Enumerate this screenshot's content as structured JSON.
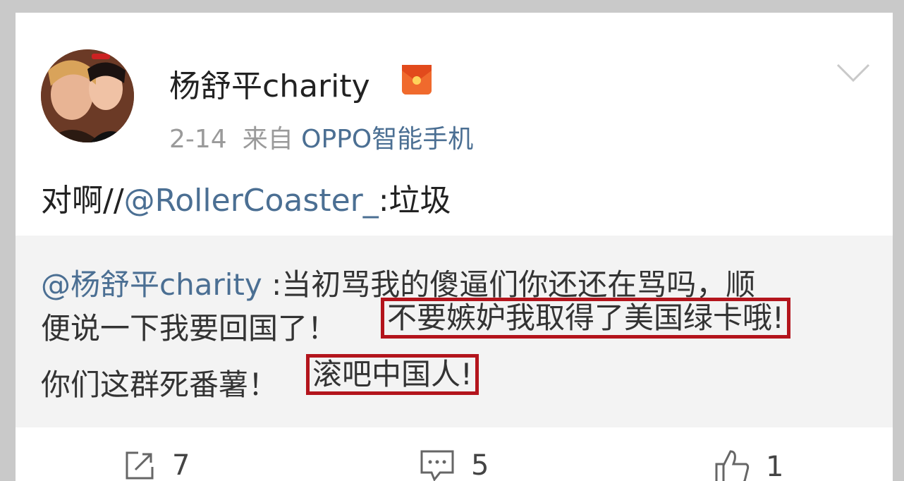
{
  "post": {
    "username": "杨舒平charity",
    "date": "2-14",
    "source_prefix": "来自",
    "source": "OPPO智能手机",
    "text_prefix": "对啊//",
    "text_mention": "@RollerCoaster_",
    "text_suffix": ":垃圾"
  },
  "quoted": {
    "mention": "@杨舒平charity",
    "line1_rest": " :当初骂我的傻逼们你还还在骂吗，顺",
    "line2_plain": "便说一下我要回国了！",
    "line2_highlight": "不要嫉妒我取得了美国绿卡哦!",
    "line3_plain": "你们这群死番薯！",
    "line3_highlight": "滚吧中国人!"
  },
  "actions": {
    "repost_count": "7",
    "comment_count": "5",
    "like_count": "1"
  },
  "colors": {
    "link": "#4b6f93",
    "highlight_border": "#b3141c",
    "badge": "#f06a2d"
  }
}
